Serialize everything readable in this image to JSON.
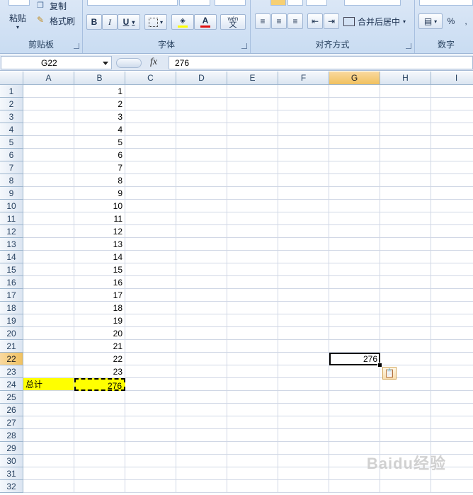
{
  "ribbon": {
    "clipboard": {
      "paste_label": "粘贴",
      "copy_label": "复制",
      "format_painter_label": "格式刷",
      "group_label": "剪贴板"
    },
    "font": {
      "group_label": "字体",
      "bold": "B",
      "italic": "I",
      "underline": "U",
      "font_color_glyph": "A",
      "phonetic_glyph": "wén",
      "phonetic_sub": "文"
    },
    "alignment": {
      "group_label": "对齐方式",
      "merge_center_label": "合并后居中"
    },
    "number": {
      "group_label": "数字",
      "percent": "%"
    }
  },
  "formula_bar": {
    "name_box": "G22",
    "fx": "fx",
    "value": "276"
  },
  "columns": [
    "A",
    "B",
    "C",
    "D",
    "E",
    "F",
    "G",
    "H",
    "I"
  ],
  "selected_column": "G",
  "selected_row": 22,
  "rows": [
    {
      "n": "1",
      "a": "",
      "b": "1",
      "g": ""
    },
    {
      "n": "2",
      "a": "",
      "b": "2",
      "g": ""
    },
    {
      "n": "3",
      "a": "",
      "b": "3",
      "g": ""
    },
    {
      "n": "4",
      "a": "",
      "b": "4",
      "g": ""
    },
    {
      "n": "5",
      "a": "",
      "b": "5",
      "g": ""
    },
    {
      "n": "6",
      "a": "",
      "b": "6",
      "g": ""
    },
    {
      "n": "7",
      "a": "",
      "b": "7",
      "g": ""
    },
    {
      "n": "8",
      "a": "",
      "b": "8",
      "g": ""
    },
    {
      "n": "9",
      "a": "",
      "b": "9",
      "g": ""
    },
    {
      "n": "10",
      "a": "",
      "b": "10",
      "g": ""
    },
    {
      "n": "11",
      "a": "",
      "b": "11",
      "g": ""
    },
    {
      "n": "12",
      "a": "",
      "b": "12",
      "g": ""
    },
    {
      "n": "13",
      "a": "",
      "b": "13",
      "g": ""
    },
    {
      "n": "14",
      "a": "",
      "b": "14",
      "g": ""
    },
    {
      "n": "15",
      "a": "",
      "b": "15",
      "g": ""
    },
    {
      "n": "16",
      "a": "",
      "b": "16",
      "g": ""
    },
    {
      "n": "17",
      "a": "",
      "b": "17",
      "g": ""
    },
    {
      "n": "18",
      "a": "",
      "b": "18",
      "g": ""
    },
    {
      "n": "19",
      "a": "",
      "b": "19",
      "g": ""
    },
    {
      "n": "20",
      "a": "",
      "b": "20",
      "g": ""
    },
    {
      "n": "21",
      "a": "",
      "b": "21",
      "g": ""
    },
    {
      "n": "22",
      "a": "",
      "b": "22",
      "g": "276"
    },
    {
      "n": "23",
      "a": "",
      "b": "23",
      "g": ""
    },
    {
      "n": "24",
      "a": "总计",
      "b": "276",
      "g": ""
    },
    {
      "n": "25",
      "a": "",
      "b": "",
      "g": ""
    },
    {
      "n": "26",
      "a": "",
      "b": "",
      "g": ""
    },
    {
      "n": "27",
      "a": "",
      "b": "",
      "g": ""
    },
    {
      "n": "28",
      "a": "",
      "b": "",
      "g": ""
    },
    {
      "n": "29",
      "a": "",
      "b": "",
      "g": ""
    },
    {
      "n": "30",
      "a": "",
      "b": "",
      "g": ""
    },
    {
      "n": "31",
      "a": "",
      "b": "",
      "g": ""
    },
    {
      "n": "32",
      "a": "",
      "b": "",
      "g": ""
    }
  ],
  "colors": {
    "highlight": "#ffff00",
    "selected_header": "#f1c15f"
  },
  "watermark": "Baidu经验"
}
